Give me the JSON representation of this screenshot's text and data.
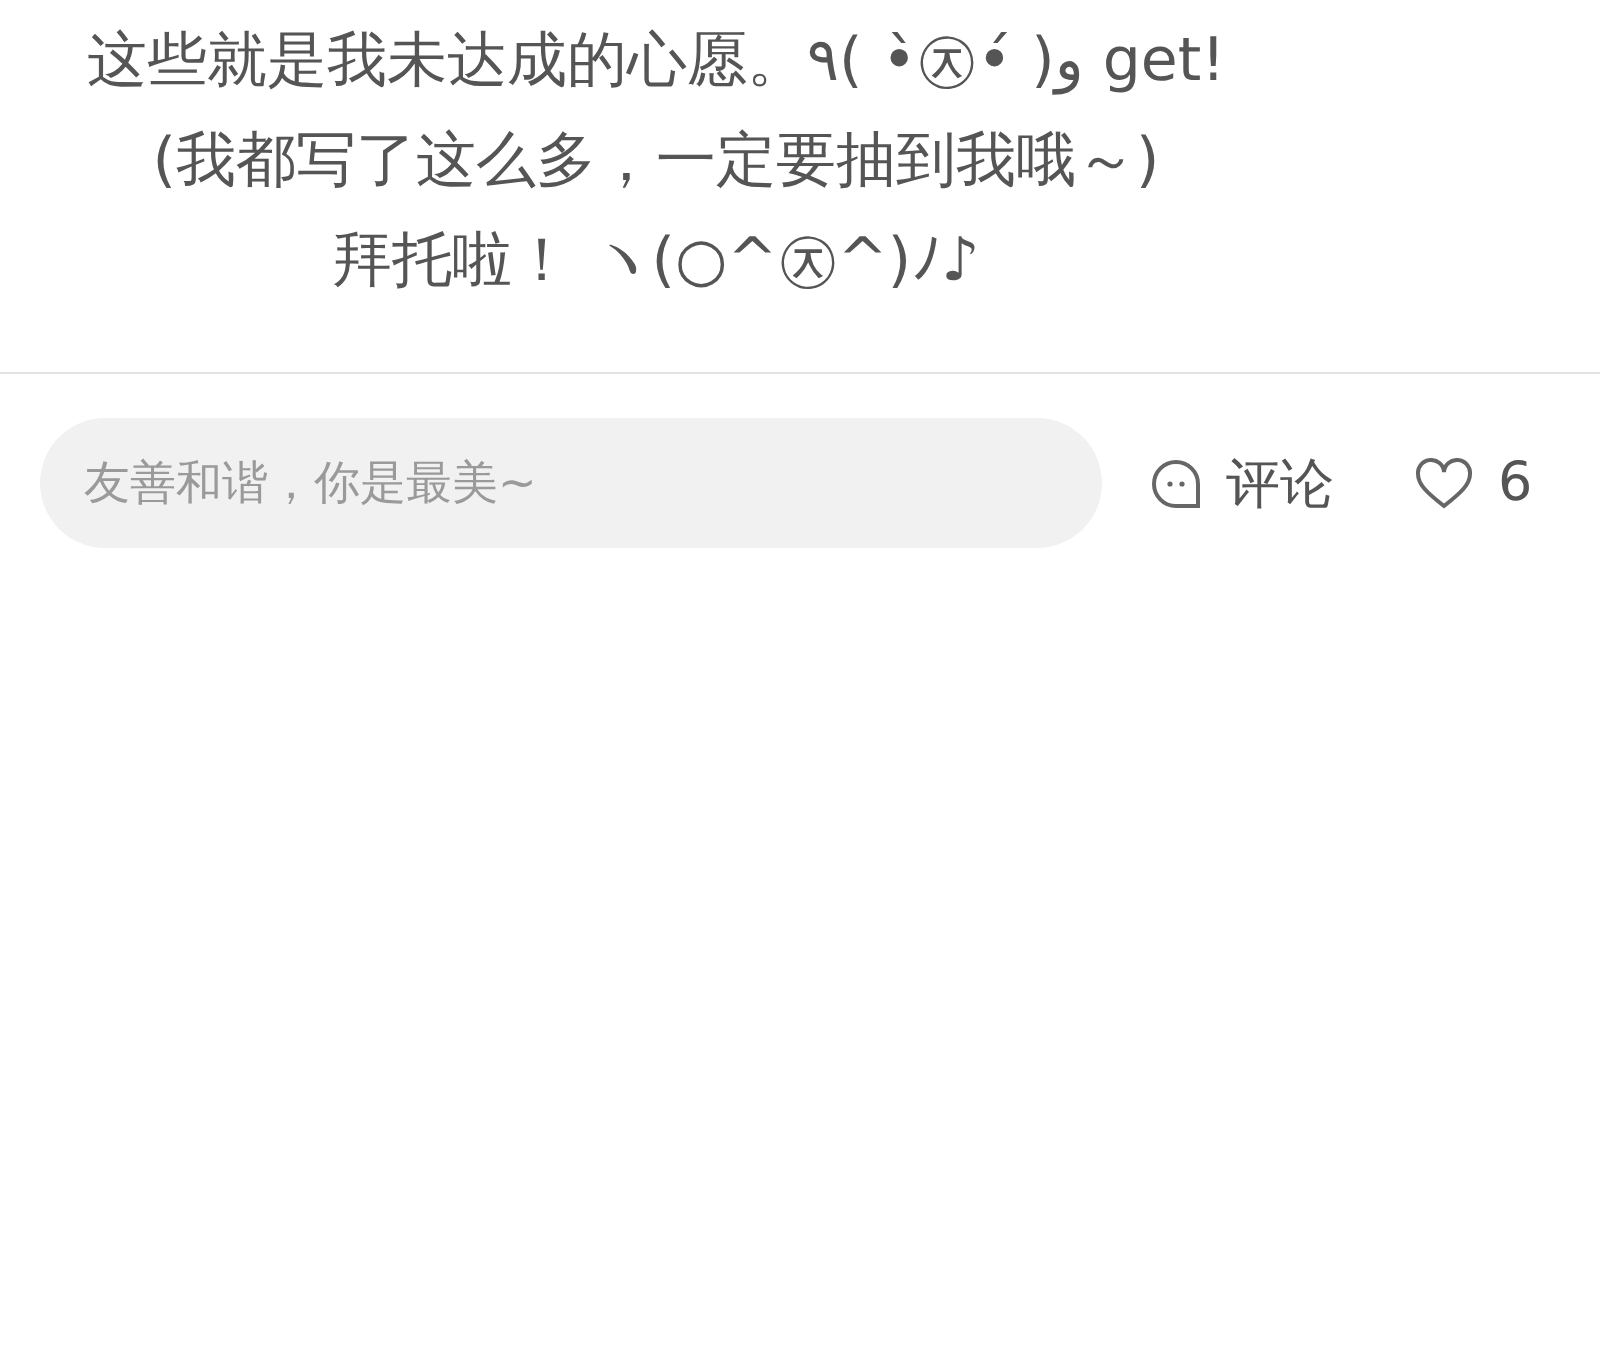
{
  "post": {
    "lines": [
      "这些就是我未达成的心愿。٩( •̀㉨•́ )و get!",
      "(我都写了这么多，一定要抽到我哦～)",
      "拜托啦！ ヽ(○^㉨^)ﾉ♪"
    ]
  },
  "comment_bar": {
    "placeholder": "友善和谐，你是最美~",
    "comment_label": "评论",
    "like_count": "6",
    "liked": false
  }
}
